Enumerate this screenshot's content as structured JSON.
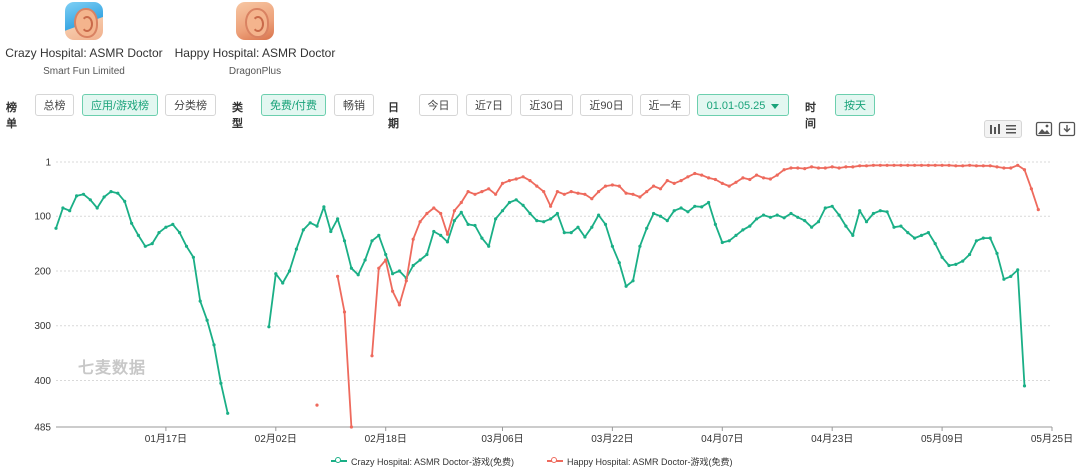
{
  "apps": [
    {
      "name": "Crazy Hospital: ASMR Doctor",
      "developer": "Smart Fun Limited"
    },
    {
      "name": "Happy Hospital: ASMR Doctor",
      "developer": "DragonPlus"
    }
  ],
  "filters": {
    "list_label": "榜单",
    "list_options": [
      "总榜",
      "应用/游戏榜",
      "分类榜"
    ],
    "list_active": "应用/游戏榜",
    "type_label": "类型",
    "type_options": [
      "免费/付费",
      "畅销"
    ],
    "type_active": "免费/付费",
    "date_label": "日期",
    "date_options": [
      "今日",
      "近7日",
      "近30日",
      "近90日",
      "近一年"
    ],
    "date_range": "01.01-05.25",
    "time_label": "时间",
    "time_option": "按天"
  },
  "tools": [
    "bar-chart-icon",
    "list-icon",
    "image-icon",
    "download-icon"
  ],
  "watermark": "七麦数据",
  "colors": {
    "crazy": "#1aaf86",
    "happy": "#ee6a5d",
    "accent": "#1aa37a"
  },
  "chart_data": {
    "type": "line",
    "y_axis_inverted": true,
    "ylim": [
      1,
      485
    ],
    "yticks": [
      1,
      100,
      200,
      300,
      400,
      485
    ],
    "xlim": [
      "2024-01-01",
      "2024-05-25"
    ],
    "xticks": [
      "01月17日",
      "02月02日",
      "02月18日",
      "03月06日",
      "03月22日",
      "04月07日",
      "04月23日",
      "05月09日",
      "05月25日"
    ],
    "grid": true,
    "legend_position": "bottom",
    "series": [
      {
        "name": "Crazy Hospital: ASMR Doctor-游戏(免费)",
        "color": "#1aaf86",
        "points": [
          [
            0,
            122
          ],
          [
            1,
            85
          ],
          [
            2,
            90
          ],
          [
            3,
            63
          ],
          [
            4,
            60
          ],
          [
            5,
            70
          ],
          [
            6,
            85
          ],
          [
            7,
            65
          ],
          [
            8,
            55
          ],
          [
            9,
            58
          ],
          [
            10,
            73
          ],
          [
            11,
            113
          ],
          [
            12,
            135
          ],
          [
            13,
            155
          ],
          [
            14,
            150
          ],
          [
            15,
            130
          ],
          [
            16,
            120
          ],
          [
            17,
            115
          ],
          [
            18,
            130
          ],
          [
            19,
            155
          ],
          [
            20,
            175
          ],
          [
            21,
            255
          ],
          [
            22,
            290
          ],
          [
            23,
            335
          ],
          [
            24,
            405
          ],
          [
            25,
            460
          ],
          [
            31,
            302
          ],
          [
            32,
            205
          ],
          [
            33,
            222
          ],
          [
            34,
            200
          ],
          [
            35,
            160
          ],
          [
            36,
            125
          ],
          [
            37,
            112
          ],
          [
            38,
            118
          ],
          [
            39,
            83
          ],
          [
            40,
            128
          ],
          [
            41,
            105
          ],
          [
            42,
            145
          ],
          [
            43,
            195
          ],
          [
            44,
            207
          ],
          [
            45,
            180
          ],
          [
            46,
            145
          ],
          [
            47,
            135
          ],
          [
            48,
            170
          ],
          [
            49,
            205
          ],
          [
            50,
            200
          ],
          [
            51,
            213
          ],
          [
            52,
            190
          ],
          [
            53,
            180
          ],
          [
            54,
            170
          ],
          [
            55,
            128
          ],
          [
            56,
            135
          ],
          [
            57,
            147
          ],
          [
            58,
            108
          ],
          [
            59,
            93
          ],
          [
            60,
            115
          ],
          [
            61,
            117
          ],
          [
            62,
            140
          ],
          [
            63,
            155
          ],
          [
            64,
            105
          ],
          [
            65,
            90
          ],
          [
            66,
            75
          ],
          [
            67,
            70
          ],
          [
            68,
            80
          ],
          [
            69,
            95
          ],
          [
            70,
            108
          ],
          [
            71,
            110
          ],
          [
            72,
            105
          ],
          [
            73,
            95
          ],
          [
            74,
            130
          ],
          [
            75,
            130
          ],
          [
            76,
            120
          ],
          [
            77,
            138
          ],
          [
            78,
            120
          ],
          [
            79,
            98
          ],
          [
            80,
            115
          ],
          [
            81,
            155
          ],
          [
            82,
            185
          ],
          [
            83,
            228
          ],
          [
            84,
            218
          ],
          [
            85,
            155
          ],
          [
            86,
            122
          ],
          [
            87,
            95
          ],
          [
            88,
            100
          ],
          [
            89,
            108
          ],
          [
            90,
            90
          ],
          [
            91,
            85
          ],
          [
            92,
            92
          ],
          [
            93,
            82
          ],
          [
            94,
            83
          ],
          [
            95,
            75
          ],
          [
            96,
            115
          ],
          [
            97,
            148
          ],
          [
            98,
            145
          ],
          [
            99,
            135
          ],
          [
            100,
            125
          ],
          [
            101,
            118
          ],
          [
            102,
            105
          ],
          [
            103,
            98
          ],
          [
            104,
            102
          ],
          [
            105,
            98
          ],
          [
            106,
            103
          ],
          [
            107,
            95
          ],
          [
            108,
            102
          ],
          [
            109,
            108
          ],
          [
            110,
            120
          ],
          [
            111,
            110
          ],
          [
            112,
            85
          ],
          [
            113,
            82
          ],
          [
            114,
            98
          ],
          [
            115,
            118
          ],
          [
            116,
            135
          ],
          [
            117,
            90
          ],
          [
            118,
            110
          ],
          [
            119,
            95
          ],
          [
            120,
            90
          ],
          [
            121,
            92
          ],
          [
            122,
            120
          ],
          [
            123,
            118
          ],
          [
            124,
            130
          ],
          [
            125,
            140
          ],
          [
            126,
            135
          ],
          [
            127,
            130
          ],
          [
            128,
            150
          ],
          [
            129,
            175
          ],
          [
            130,
            190
          ],
          [
            131,
            188
          ],
          [
            132,
            182
          ],
          [
            133,
            170
          ],
          [
            134,
            145
          ],
          [
            135,
            140
          ],
          [
            136,
            140
          ],
          [
            137,
            168
          ],
          [
            138,
            215
          ],
          [
            139,
            210
          ],
          [
            140,
            198
          ],
          [
            141,
            410
          ]
        ]
      },
      {
        "name": "Happy Hospital: ASMR Doctor-游戏(免费)",
        "color": "#ee6a5d",
        "points": [
          [
            38,
            445
          ],
          [
            41,
            210
          ],
          [
            42,
            275
          ],
          [
            43,
            485
          ],
          [
            46,
            355
          ],
          [
            47,
            195
          ],
          [
            48,
            180
          ],
          [
            49,
            237
          ],
          [
            50,
            262
          ],
          [
            51,
            218
          ],
          [
            52,
            142
          ],
          [
            53,
            110
          ],
          [
            54,
            95
          ],
          [
            55,
            85
          ],
          [
            56,
            95
          ],
          [
            57,
            133
          ],
          [
            58,
            90
          ],
          [
            59,
            75
          ],
          [
            60,
            55
          ],
          [
            61,
            60
          ],
          [
            62,
            55
          ],
          [
            63,
            50
          ],
          [
            64,
            60
          ],
          [
            65,
            40
          ],
          [
            66,
            35
          ],
          [
            67,
            32
          ],
          [
            68,
            28
          ],
          [
            69,
            35
          ],
          [
            70,
            45
          ],
          [
            71,
            55
          ],
          [
            72,
            82
          ],
          [
            73,
            55
          ],
          [
            74,
            60
          ],
          [
            75,
            55
          ],
          [
            76,
            58
          ],
          [
            77,
            60
          ],
          [
            78,
            68
          ],
          [
            79,
            55
          ],
          [
            80,
            45
          ],
          [
            81,
            43
          ],
          [
            82,
            45
          ],
          [
            83,
            58
          ],
          [
            84,
            60
          ],
          [
            85,
            65
          ],
          [
            86,
            55
          ],
          [
            87,
            45
          ],
          [
            88,
            50
          ],
          [
            89,
            35
          ],
          [
            90,
            40
          ],
          [
            91,
            35
          ],
          [
            92,
            28
          ],
          [
            93,
            22
          ],
          [
            94,
            25
          ],
          [
            95,
            30
          ],
          [
            96,
            33
          ],
          [
            97,
            40
          ],
          [
            98,
            45
          ],
          [
            99,
            38
          ],
          [
            100,
            30
          ],
          [
            101,
            33
          ],
          [
            102,
            25
          ],
          [
            103,
            30
          ],
          [
            104,
            32
          ],
          [
            105,
            25
          ],
          [
            106,
            15
          ],
          [
            107,
            12
          ],
          [
            108,
            12
          ],
          [
            109,
            13
          ],
          [
            110,
            10
          ],
          [
            111,
            12
          ],
          [
            112,
            12
          ],
          [
            113,
            10
          ],
          [
            114,
            12
          ],
          [
            115,
            10
          ],
          [
            116,
            10
          ],
          [
            117,
            8
          ],
          [
            118,
            8
          ],
          [
            119,
            7
          ],
          [
            120,
            7
          ],
          [
            121,
            7
          ],
          [
            122,
            7
          ],
          [
            123,
            7
          ],
          [
            124,
            7
          ],
          [
            125,
            7
          ],
          [
            126,
            7
          ],
          [
            127,
            7
          ],
          [
            128,
            7
          ],
          [
            129,
            7
          ],
          [
            130,
            7
          ],
          [
            131,
            8
          ],
          [
            132,
            8
          ],
          [
            133,
            7
          ],
          [
            134,
            8
          ],
          [
            135,
            8
          ],
          [
            136,
            8
          ],
          [
            137,
            10
          ],
          [
            138,
            12
          ],
          [
            139,
            12
          ],
          [
            140,
            7
          ],
          [
            141,
            15
          ],
          [
            142,
            50
          ],
          [
            143,
            88
          ]
        ]
      }
    ]
  }
}
